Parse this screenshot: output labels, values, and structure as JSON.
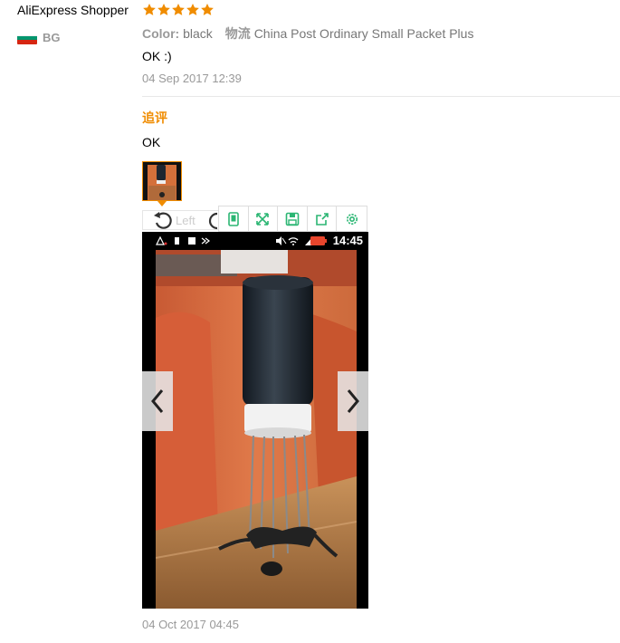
{
  "review": {
    "reviewer_name": "AliExpress Shopper",
    "rating_stars": 5,
    "country_code": "BG",
    "color_label": "Color:",
    "color_value": "black",
    "shipping_label": "物流",
    "shipping_value": "China Post Ordinary Small Packet Plus",
    "text": "OK :)",
    "date": "04 Sep 2017 12:39"
  },
  "followup": {
    "label": "追评",
    "text": "OK",
    "date": "04 Oct 2017 04:45"
  },
  "viewer": {
    "rotate_left_label": "Left",
    "status_time": "14:45",
    "toolbar_icons": [
      "phone-icon",
      "expand-icon",
      "save-icon",
      "share-icon",
      "settings-icon"
    ]
  },
  "colors": {
    "accent": "#f08c00",
    "toolbar_icon": "#2bb673",
    "star": "#f08c00"
  }
}
